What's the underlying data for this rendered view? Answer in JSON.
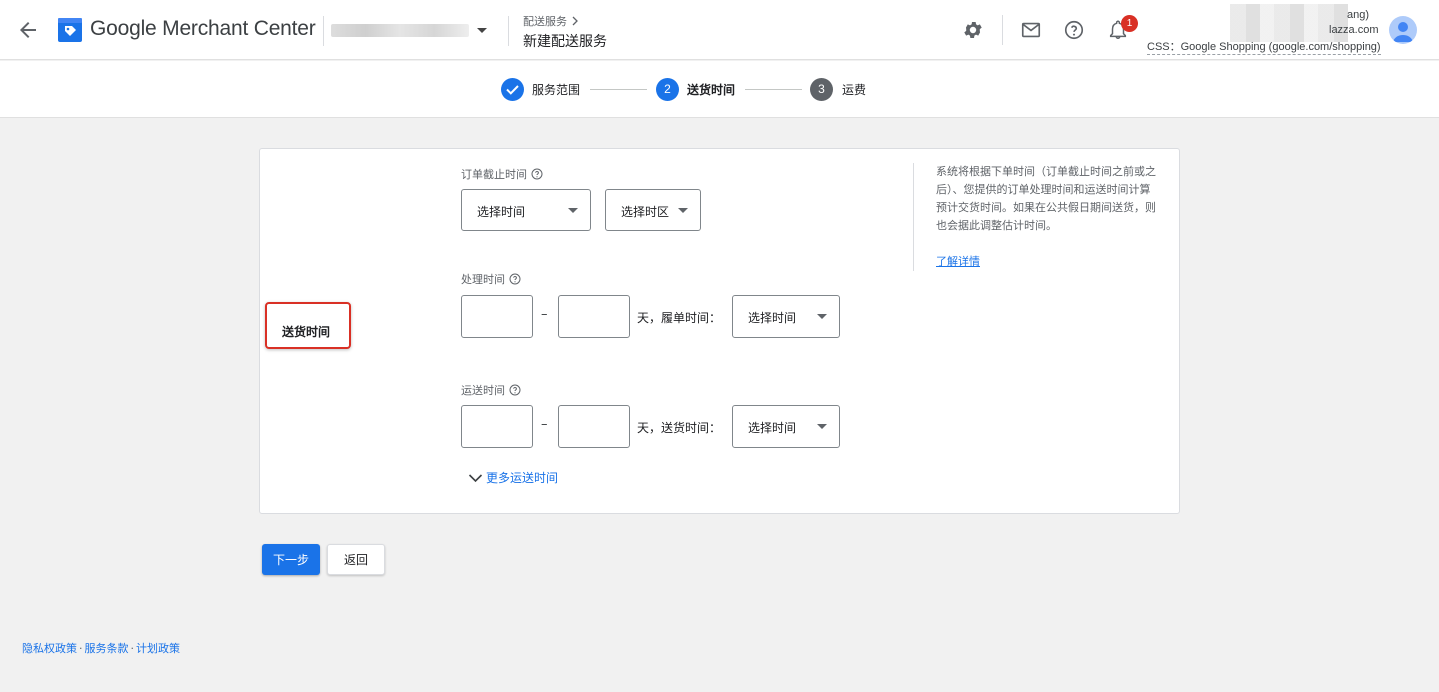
{
  "header": {
    "app_title": "Google Merchant Center",
    "breadcrumb_parent": "配送服务",
    "page_title": "新建配送服务",
    "notification_count": "1",
    "user_name_partial": "ang)",
    "user_email_partial": "lazza.com",
    "css_label": "CSS：Google Shopping (google.com/shopping)"
  },
  "stepper": {
    "steps": [
      {
        "label": "服务范围",
        "number": "",
        "state": "done"
      },
      {
        "label": "送货时间",
        "number": "2",
        "state": "active"
      },
      {
        "label": "运费",
        "number": "3",
        "state": "upcoming"
      }
    ]
  },
  "form": {
    "section_title": "送货时间",
    "cutoff": {
      "label": "订单截止时间",
      "time_placeholder": "选择时间",
      "timezone_placeholder": "选择时区"
    },
    "handling": {
      "label": "处理时间",
      "min_value": "",
      "max_value": "",
      "dash": "–",
      "suffix": "天，履单时间：",
      "time_placeholder": "选择时间"
    },
    "transit": {
      "label": "运送时间",
      "min_value": "",
      "max_value": "",
      "dash": "–",
      "suffix": "天，送货时间：",
      "time_placeholder": "选择时间"
    },
    "more_link": "更多运送时间",
    "help_text": "系统将根据下单时间（订单截止时间之前或之后）、您提供的订单处理时间和运送时间计算预计交货时间。如果在公共假日期间送货，则也会据此调整估计时间。",
    "learn_more": "了解详情"
  },
  "actions": {
    "next": "下一步",
    "back": "返回"
  },
  "footer": {
    "privacy": "隐私权政策",
    "terms": "服务条款",
    "program": "计划政策",
    "separator": "·"
  },
  "colors": {
    "primary": "#1a73e8",
    "highlight_border": "#d93025",
    "badge": "#d93025",
    "upcoming_step": "#5f6368"
  }
}
